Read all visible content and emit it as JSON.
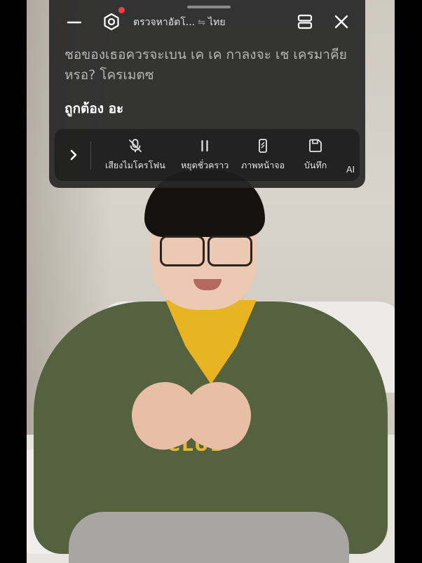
{
  "header": {
    "language_source": "ตรวจหาอัตโ...",
    "swap_symbol": "⇋",
    "language_target": "ไทย"
  },
  "transcript": {
    "source_text": "ชอของเธอควรจะเบน เค เค กาลงจะ เช เครมาคียหรอ? โครเมตซ",
    "translated_text": "ถูกต้อง อะ"
  },
  "toolbar": {
    "mic_label": "เสียงไมโครโฟน",
    "pause_label": "หยุดชั่วคราว",
    "screen_label": "ภาพหน้าจอ",
    "save_label": "บันทึก",
    "ai_label": "AI"
  },
  "video": {
    "shirt_text": "CLUB"
  },
  "colors": {
    "panel_bg": "#282828",
    "notification_dot": "#ff3b44",
    "source_text": "#b6b6b6",
    "translated_text": "#ffffff"
  },
  "icons": {
    "minimize": "minus-icon",
    "settings": "hexagon-gear-icon",
    "layout": "split-layout-icon",
    "close": "close-icon",
    "expand": "chevron-right-icon",
    "mic": "mic-off-icon",
    "pause": "pause-icon",
    "screen": "phone-screen-icon",
    "save": "save-icon"
  }
}
